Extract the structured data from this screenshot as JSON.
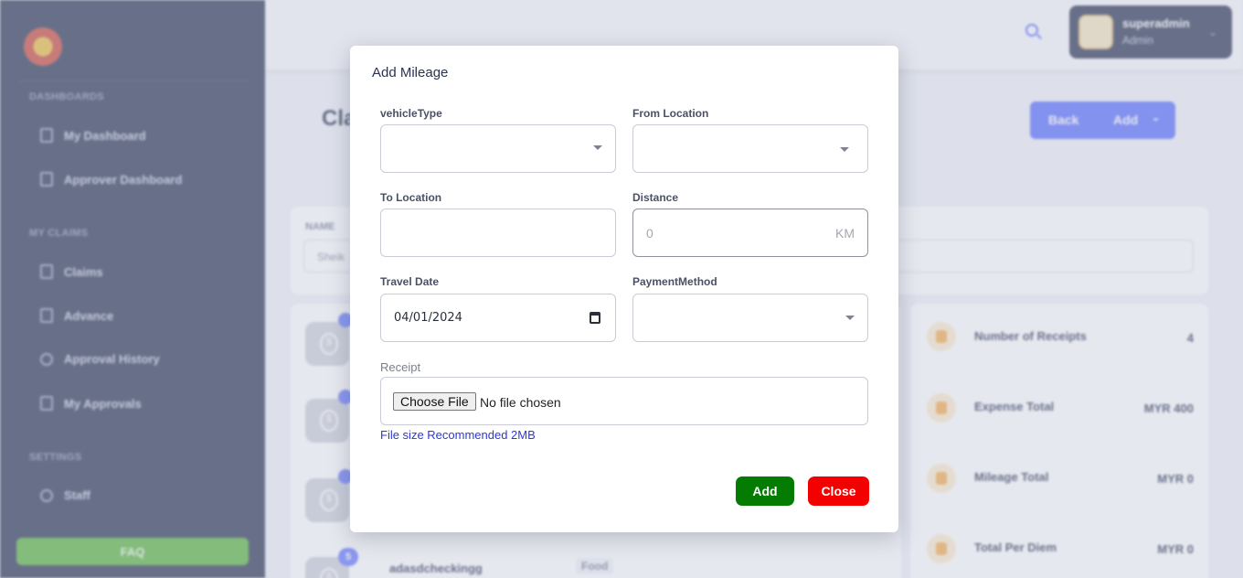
{
  "background": {
    "sidebar": {
      "sections": [
        {
          "title": "DASHBOARDS",
          "items": [
            "My Dashboard",
            "Approver Dashboard"
          ]
        },
        {
          "title": "MY CLAIMS",
          "items": [
            "Claims",
            "Advance",
            "Approval History",
            "My Approvals"
          ]
        },
        {
          "title": "SETTINGS",
          "items": [
            "Staff"
          ]
        }
      ],
      "faq_label": "FAQ"
    },
    "user": {
      "name": "superadmin",
      "role": "Admin"
    },
    "page_title_fragment": "Cla",
    "header_buttons": {
      "back": "Back",
      "add": "Add"
    },
    "filter": {
      "label": "NAME",
      "value": "Sheik"
    },
    "list": {
      "badge_count": "5",
      "row_title": "adasdcheckingg",
      "row_tag": "Food"
    },
    "stats": [
      {
        "label": "Number of Receipts",
        "value": "4"
      },
      {
        "label": "Expense Total",
        "value": "MYR 400"
      },
      {
        "label": "Mileage Total",
        "value": "MYR 0"
      },
      {
        "label": "Total Per Diem",
        "value": "MYR 0"
      }
    ]
  },
  "modal": {
    "title": "Add Mileage",
    "fields": {
      "vehicle_type": {
        "label": "vehicleType",
        "value": ""
      },
      "from_location": {
        "label": "From Location",
        "value": ""
      },
      "to_location": {
        "label": "To Location",
        "value": ""
      },
      "distance": {
        "label": "Distance",
        "placeholder": "0",
        "unit": "KM"
      },
      "travel_date": {
        "label": "Travel Date",
        "value": "04/01/2024"
      },
      "payment_method": {
        "label": "PaymentMethod",
        "value": ""
      },
      "receipt": {
        "label": "Receipt",
        "button": "Choose File",
        "status": "No file chosen",
        "hint": "File size Recommended 2MB"
      }
    },
    "buttons": {
      "add": "Add",
      "close": "Close"
    }
  },
  "colors": {
    "add_button": "#047c04",
    "close_button": "#f30000",
    "hint_text": "#2d3ad0",
    "sidebar_bg": "#1b2546",
    "accent": "#4d63ff"
  }
}
